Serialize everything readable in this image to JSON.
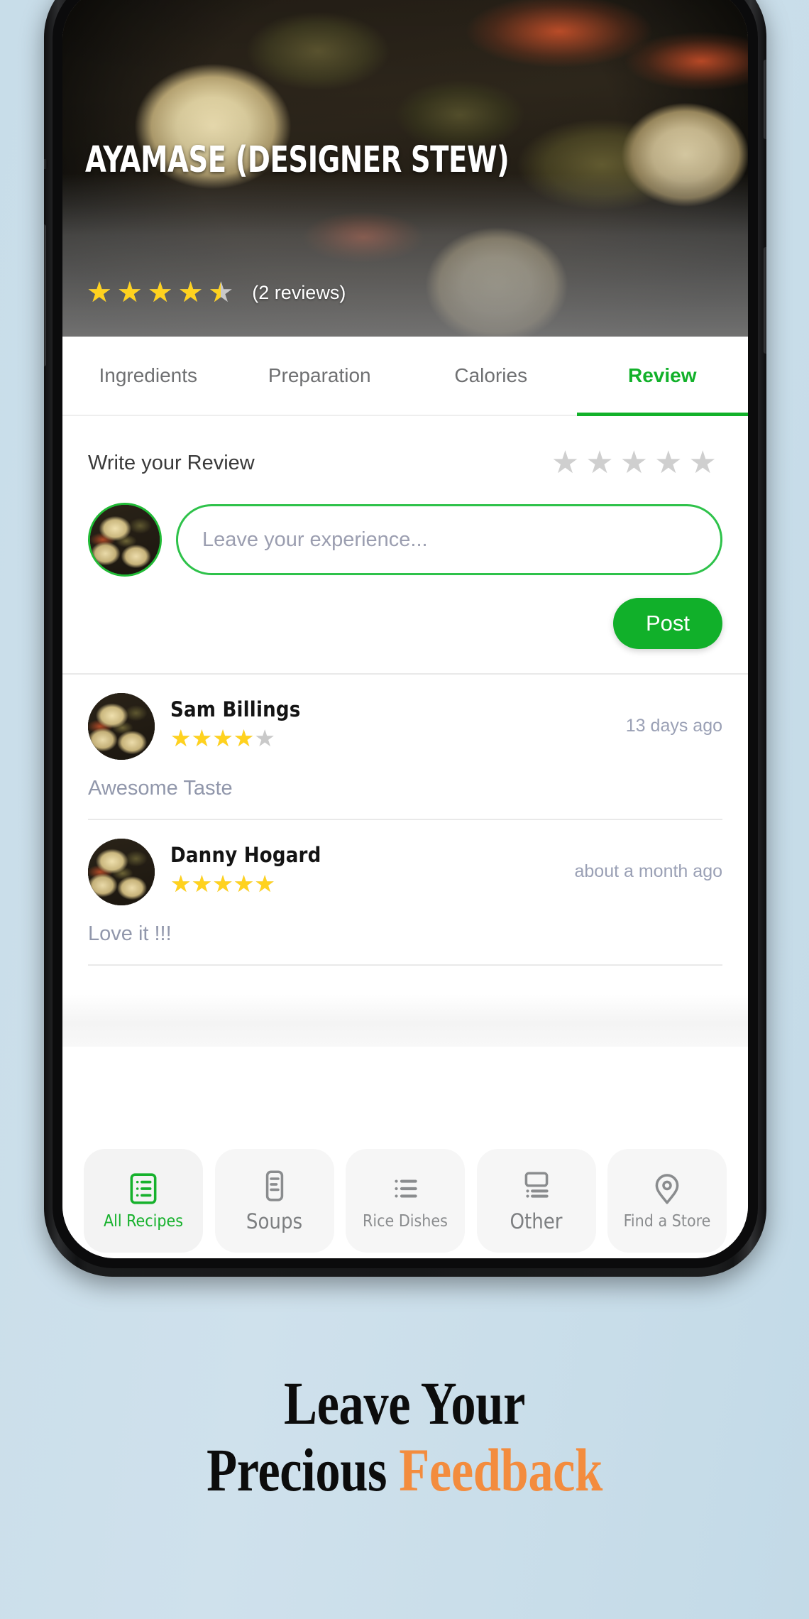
{
  "background_color": "#c8dde9",
  "phone": {
    "frame_color": "#171819"
  },
  "hero": {
    "title": "Ayamase (Designer Stew)",
    "rating": 4.5,
    "review_count_label": "(2 reviews)",
    "star_color": "#ffd21e",
    "empty_star_color": "#c9c9c9"
  },
  "tabs": {
    "accent_color": "#12b12a",
    "items": [
      {
        "label": "Ingredients",
        "active": false
      },
      {
        "label": "Preparation",
        "active": false
      },
      {
        "label": "Calories",
        "active": false
      },
      {
        "label": "Review",
        "active": true
      }
    ]
  },
  "write_review": {
    "label": "Write your Review",
    "rating": 0,
    "avatar_name": "user-avatar",
    "input_placeholder": "Leave your experience...",
    "input_value": "",
    "post_label": "Post",
    "post_color": "#11b02a",
    "border_color": "#2ec24a"
  },
  "reviews": [
    {
      "name": "Sam Billings",
      "rating": 4,
      "time": "13 days ago",
      "text": "Awesome Taste"
    },
    {
      "name": "Danny Hogard",
      "rating": 5,
      "time": "about a month ago",
      "text": "Love it !!!"
    }
  ],
  "bottom_nav": {
    "active_color": "#16b12c",
    "items": [
      {
        "label": "All Recipes",
        "icon": "recipe-list-icon",
        "active": true
      },
      {
        "label": "Soups",
        "icon": "soup-cup-icon",
        "active": false
      },
      {
        "label": "Rice Dishes",
        "icon": "bulleted-list-icon",
        "active": false
      },
      {
        "label": "Other",
        "icon": "other-grid-icon",
        "active": false
      },
      {
        "label": "Find a Store",
        "icon": "location-pin-icon",
        "active": false
      }
    ]
  },
  "caption": {
    "line1": "Leave Your",
    "line2_plain": "Precious ",
    "line2_accent": "Feedback",
    "accent_color": "#f38c3e"
  }
}
